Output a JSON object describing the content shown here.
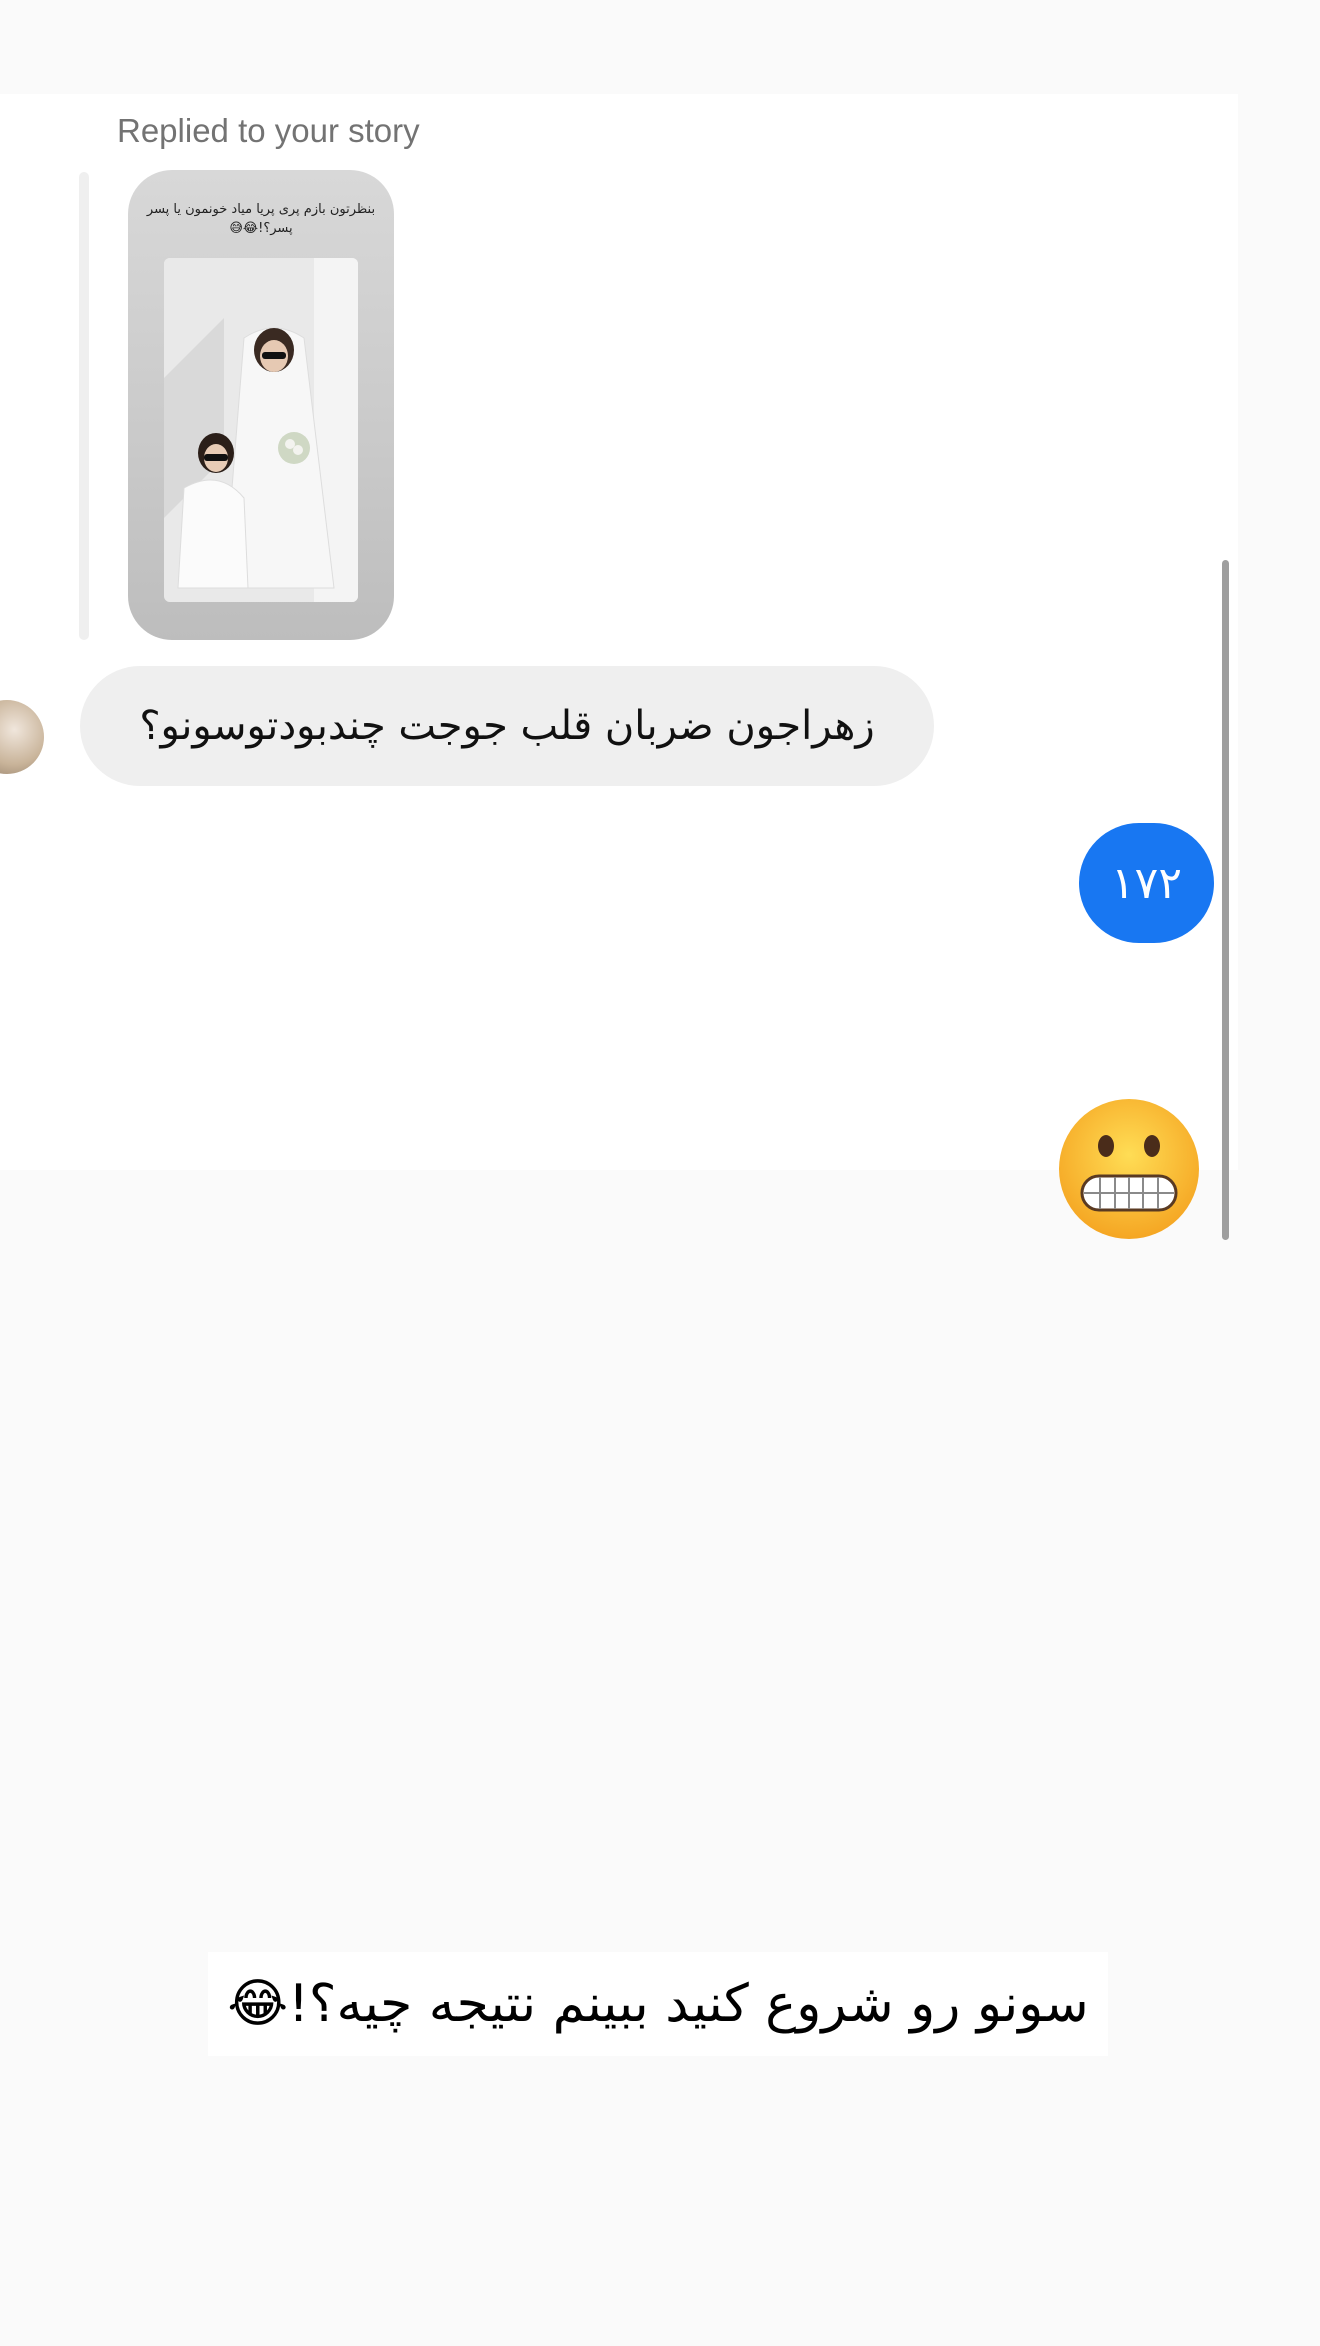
{
  "thread": {
    "replied_label": "Replied to your story",
    "story": {
      "caption": "بنظرتون بازم پری پریا میاد خونمون یا پسر پسر؟!😂😅"
    },
    "incoming_message": "زهراجون ضربان قلب جوجت چندبودتوسونو؟",
    "outgoing_message": "۱۷۲",
    "outgoing_emoji": "grimacing-face-emoji"
  },
  "overlay": {
    "caption": "سونو رو شروع کنید ببینم نتیجه چیه؟!😂"
  },
  "colors": {
    "outgoing_bubble": "#1877f2",
    "incoming_bubble": "#efefef",
    "background": "#fafafa"
  }
}
